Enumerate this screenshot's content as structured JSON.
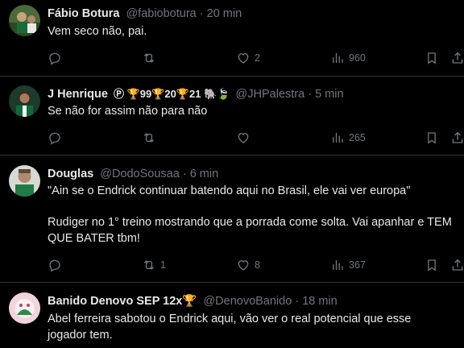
{
  "tweets": [
    {
      "name": "Fábio Botura",
      "badges": "",
      "handle": "@fabiobotura",
      "time": "20 min",
      "text": "Vem seco não, pai.",
      "replies": "",
      "reposts": "",
      "likes": "2",
      "views": "960"
    },
    {
      "name": "J Henrique",
      "badges": "Ⓟ 🏆99🏆20🏆21 🐘🍃",
      "handle": "@JHPalestra",
      "time": "5 min",
      "text": "Se não for assim não para não",
      "replies": "",
      "reposts": "",
      "likes": "",
      "views": "265"
    },
    {
      "name": "Douglas",
      "badges": "",
      "handle": "@DodoSousaa",
      "time": "6 min",
      "text": "\"Ain se o Endrick continuar batendo aqui no Brasil, ele vai ver europa\"\n\nRudiger no 1° treino mostrando que a porrada come solta. Vai apanhar e TEM QUE BATER tbm!",
      "replies": "",
      "reposts": "1",
      "likes": "8",
      "views": "367"
    },
    {
      "name": "Banido Denovo SEP 12x🏆",
      "badges": "",
      "handle": "@DenovoBanido",
      "time": "18 min",
      "text": "Abel ferreira sabotou o Endrick aqui, vão ver o real potencial que esse jogador tem.",
      "replies": "",
      "reposts": "",
      "likes": "",
      "views": ""
    }
  ],
  "separator": " · ",
  "colors": {
    "background": "#000000",
    "text": "#e7e9ea",
    "muted": "#71767b",
    "divider": "#2f3336"
  },
  "icons": [
    "reply-icon",
    "repost-icon",
    "like-icon",
    "views-icon",
    "bookmark-icon",
    "share-icon"
  ]
}
